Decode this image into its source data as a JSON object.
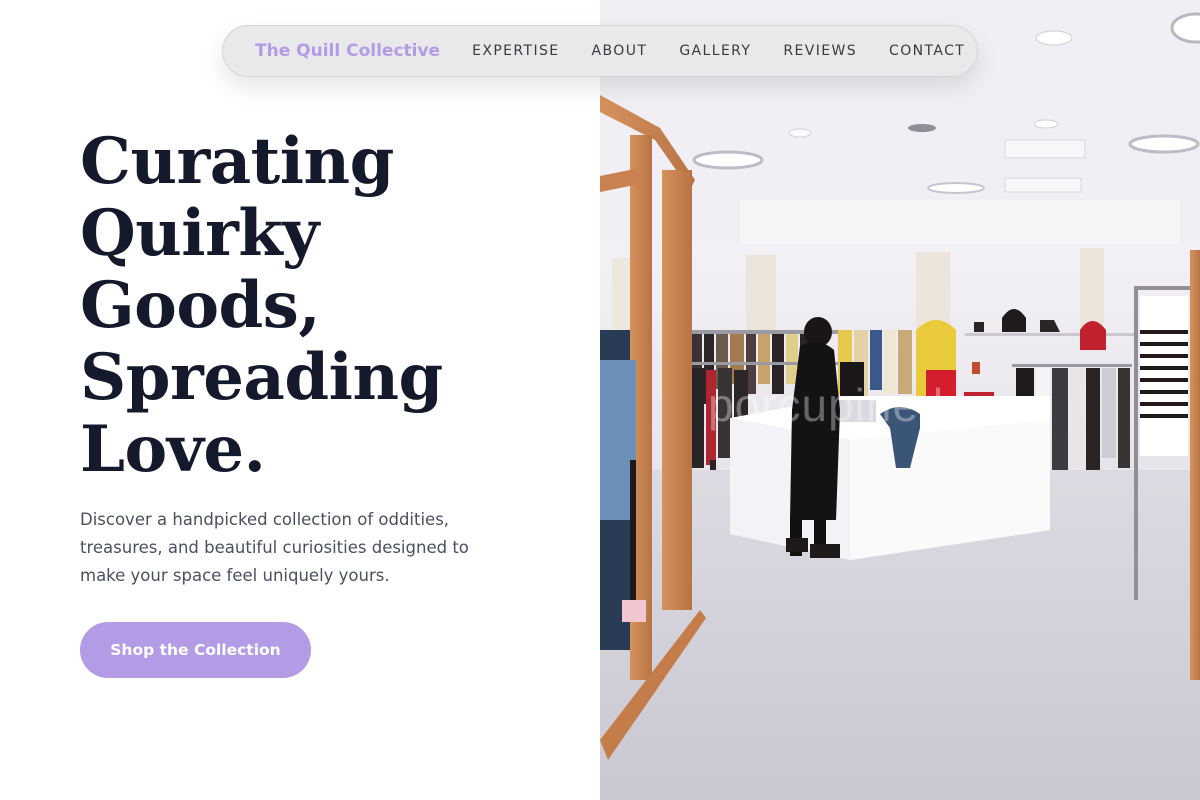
{
  "nav": {
    "brand": "The Quill Collective",
    "links": [
      "EXPERTISE",
      "ABOUT",
      "GALLERY",
      "REVIEWS",
      "CONTACT"
    ]
  },
  "hero": {
    "title_lines": [
      "Curating",
      "Quirky",
      "Goods,",
      "Spreading",
      "Love."
    ],
    "description": "Discover a handpicked collection of oddities, treasures, and beautiful curiosities designed to make your space feel uniquely yours.",
    "cta_label": "Shop the Collection"
  },
  "photo": {
    "watermark": "porcupine.love"
  },
  "colors": {
    "accent": "#b39be6",
    "heading": "#141a2c",
    "body_text": "#4a5060",
    "nav_bg": "#e8e8ea"
  }
}
